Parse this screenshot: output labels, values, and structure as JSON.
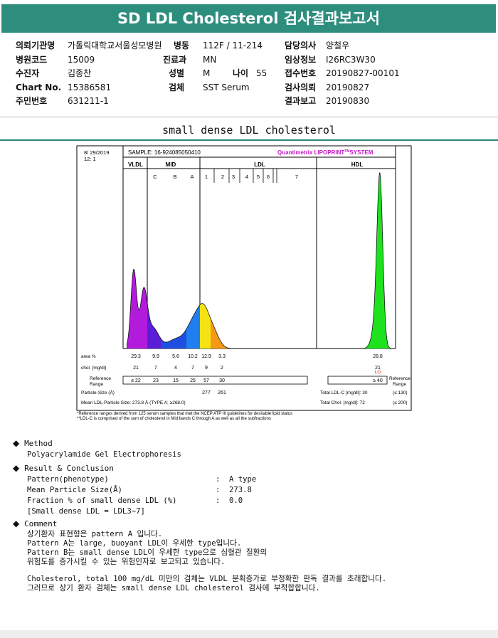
{
  "title": "SD LDL Cholesterol 검사결과보고서",
  "info": {
    "inst_label": "의뢰기관명",
    "inst_value": "가톨릭대학교서울성모병원",
    "ward_label": "병동",
    "ward_value": "112F / 11-214",
    "doctor_label": "담당의사",
    "doctor_value": "양철우",
    "hcode_label": "병원코드",
    "hcode_value": "15009",
    "dept_label": "진료과",
    "dept_value": "MN",
    "clin_label": "임상정보",
    "clin_value": "I26RC3W30",
    "patient_label": "수진자",
    "patient_value": "김종찬",
    "sex_label": "성별",
    "sex_value": "M",
    "age_label": "나이",
    "age_value": "55",
    "recv_label": "접수번호",
    "recv_value": "20190827-00101",
    "chart_label": "Chart No.",
    "chart_value": "15386581",
    "spec_label": "검체",
    "spec_value": "SST Serum",
    "req_label": "검사의뢰",
    "req_value": "20190827",
    "rrn_label": "주민번호",
    "rrn_value": "631211-1",
    "report_label": "결과보고",
    "report_value": "20190830"
  },
  "section_title": "small dense LDL cholesterol",
  "chart": {
    "date": "8/ 29/2019",
    "time": "12: 1",
    "sample": "SAMPLE:  16-924085050410",
    "brand_prefix": "Quantimetrix LIPOPRINT",
    "brand_tm": "TM",
    "brand_suffix": "SYSTEM",
    "groups": [
      "VLDL",
      "MID",
      "LDL",
      "HDL"
    ],
    "bands": [
      "C",
      "B",
      "A",
      "1",
      "2",
      "3",
      "4",
      "5",
      "6",
      "7"
    ],
    "area_label": "area %",
    "chol_label": "chol. [mg/dl]",
    "ref_label_1": "Reference",
    "ref_label_2": "Range",
    "ref_right_1": "Reference",
    "ref_right_2": "Range",
    "particle_label": "Particle-Size (Å)",
    "mean_label": "Mean LDL-Particle Size:   273.8 Å   (TYPE A; ≥268.0)",
    "total_ldl_label": "Total LDL-C [mg/dl]:  30",
    "total_ldl_ref": "(≤ 130)",
    "total_chol_label": "Total Chol. [mg/dl]:   72",
    "total_chol_ref": "(≤ 200)",
    "lo_flag": "LO",
    "footnote1": "*Reference ranges derived from 125 serum samples that met the NCEP ATP III guidelines for desirable lipid status",
    "footnote2": "**LDL-C is comprised of the sum of cholesterol in Mid bands C through A as well as all the subfractions"
  },
  "chart_data": {
    "type": "table",
    "columns": [
      "VLDL",
      "C",
      "B",
      "A",
      "1",
      "2",
      "3",
      "HDL"
    ],
    "area_percent": [
      "29.3",
      "9.9",
      "5.6",
      "10.2",
      "12.9",
      "3.3",
      "",
      "28.8"
    ],
    "chol_mg_dl": [
      "21",
      "7",
      "4",
      "7",
      "9",
      "2",
      "",
      "21"
    ],
    "reference_range": [
      "≤ 22",
      "23",
      "15",
      "25",
      "57",
      "30",
      "",
      "≥ 40"
    ],
    "particle_size": [
      "277",
      "261"
    ],
    "colors": {
      "VLDL": "#b31bdc",
      "C": "#5a1ed8",
      "B": "#1f4fe0",
      "A": "#1f7ff0",
      "LDL1": "#f5e314",
      "LDL2": "#f59a14",
      "HDL": "#1ee21e"
    }
  },
  "method": {
    "heading": "Method",
    "text": "Polyacrylamide Gel Electrophoresis"
  },
  "result": {
    "heading": "Result & Conclusion",
    "rows": [
      {
        "label": "Pattern(phenotype)",
        "sep": ":",
        "value": "A type"
      },
      {
        "label": "Mean Particle Size(Å)",
        "sep": ":",
        "value": "273.8"
      },
      {
        "label": "Fraction % of small dense LDL (%)",
        "sep": ":",
        "value": "0.0"
      }
    ],
    "note": "[Small dense LDL = LDL3~7]"
  },
  "comment": {
    "heading": "Comment",
    "lines": [
      "상기환자 표현형은 pattern A 입니다.",
      "Pattern A는 large, buoyant LDL이 우세한 type입니다.",
      "Pattern B는 small dense LDL이 우세한 type으로 심혈관 질환의",
      "위험도를 증가시킬 수 있는 위험인자로 보고되고 있습니다."
    ],
    "lines2": [
      "Cholesterol, total 100 mg/dL 미만의 검체는 VLDL 분획증가로 부정확한 판독 결과를 초래합니다.",
      "그러므로 상기 환자 검체는 small dense LDL cholesterol 검사에 부적합합니다."
    ]
  }
}
